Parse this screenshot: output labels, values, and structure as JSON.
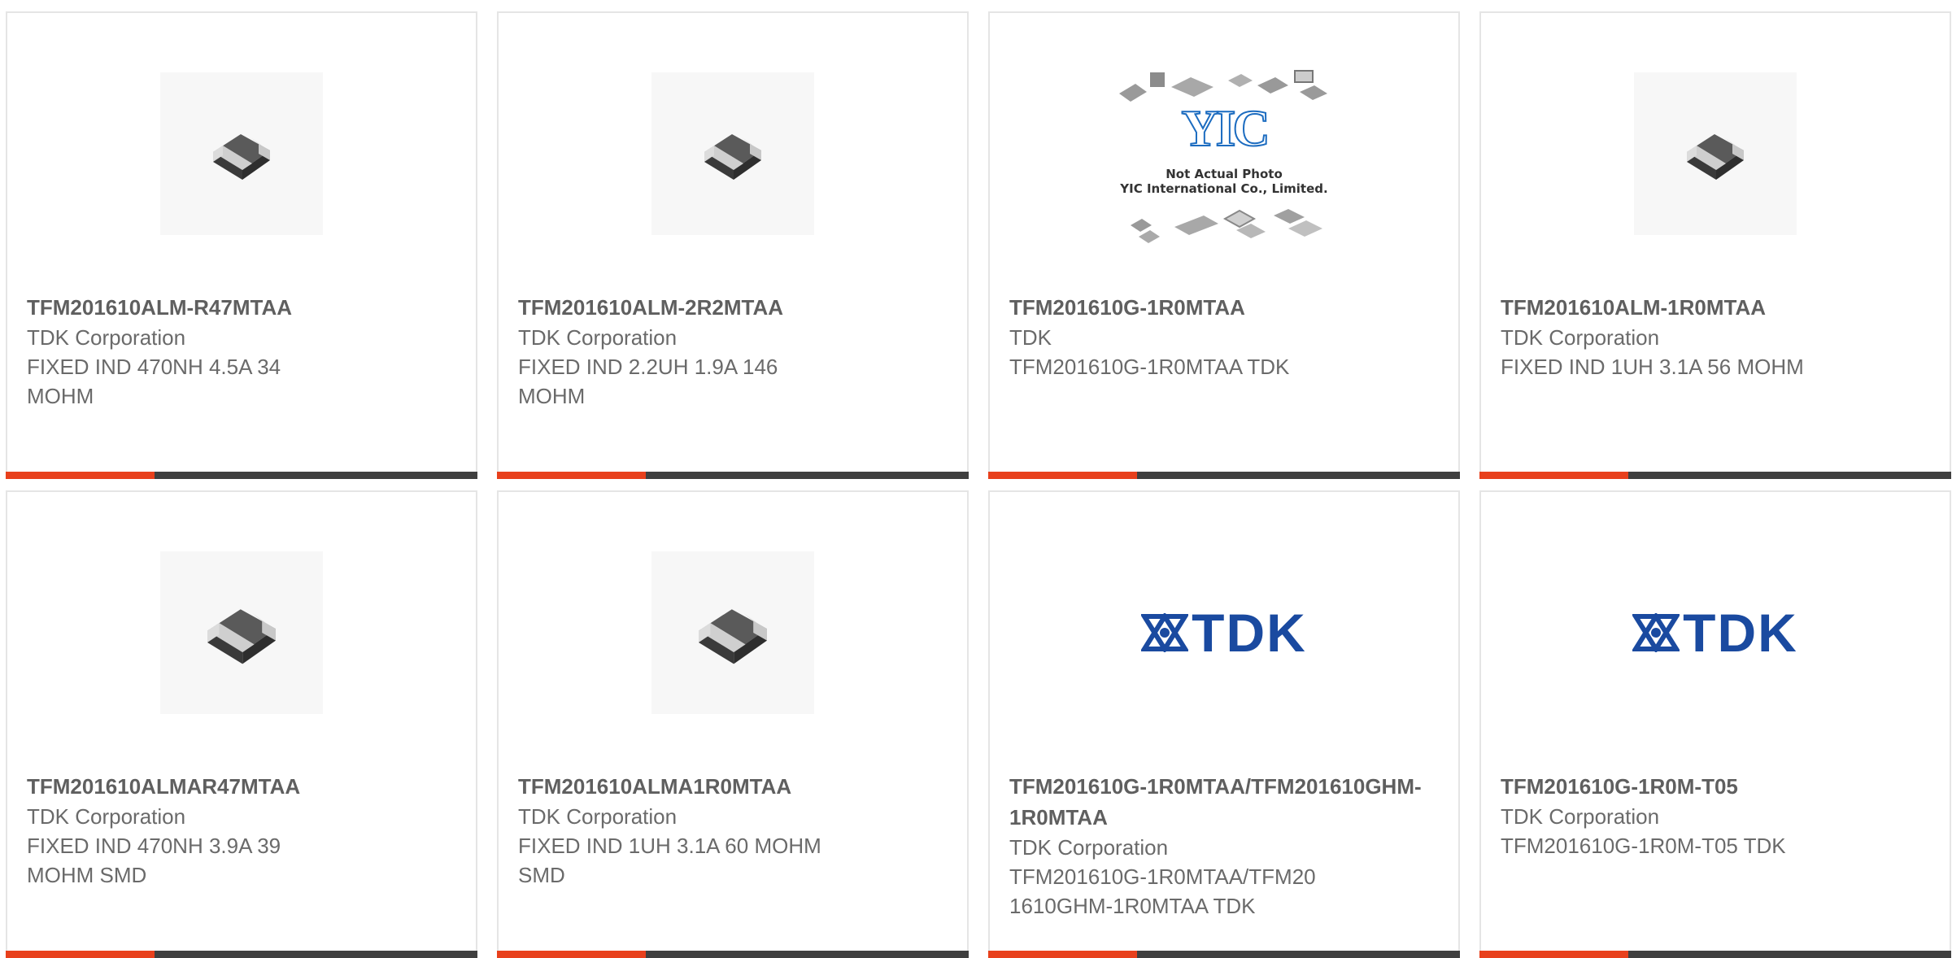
{
  "products": [
    {
      "part_number": "TFM201610ALM-R47MTAA",
      "manufacturer": "TDK Corporation",
      "description": "FIXED IND 470NH 4.5A 34 MOHM",
      "image": "chip-inductor"
    },
    {
      "part_number": "TFM201610ALM-2R2MTAA",
      "manufacturer": "TDK Corporation",
      "description": "FIXED IND 2.2UH 1.9A 146 MOHM",
      "image": "chip-inductor"
    },
    {
      "part_number": "TFM201610G-1R0MTAA",
      "manufacturer": "TDK",
      "description": "TFM201610G-1R0MTAA TDK",
      "image": "yic-placeholder"
    },
    {
      "part_number": "TFM201610ALM-1R0MTAA",
      "manufacturer": "TDK Corporation",
      "description": "FIXED IND 1UH 3.1A 56 MOHM",
      "image": "chip-inductor"
    },
    {
      "part_number": "TFM201610ALMAR47MTAA",
      "manufacturer": "TDK Corporation",
      "description": "FIXED IND 470NH 3.9A 39 MOHM SMD",
      "image": "chip-inductor"
    },
    {
      "part_number": "TFM201610ALMA1R0MTAA",
      "manufacturer": "TDK Corporation",
      "description": "FIXED IND 1UH 3.1A 60 MOHM SMD",
      "image": "chip-inductor"
    },
    {
      "part_number": "TFM201610G-1R0MTAA/TFM201610GHM-1R0MTAA",
      "manufacturer": "TDK Corporation",
      "description": "TFM201610G-1R0MTAA/TFM201610GHM-1R0MTAA TDK",
      "image": "tdk-logo"
    },
    {
      "part_number": "TFM201610G-1R0M-T05",
      "manufacturer": "TDK Corporation",
      "description": "TFM201610G-1R0M-T05 TDK",
      "image": "tdk-logo"
    }
  ],
  "placeholder_image": {
    "logo_text": "YIC",
    "caption_line1": "Not Actual Photo",
    "caption_line2": "YIC International Co., Limited."
  },
  "tdk_logo": {
    "text": "TDK"
  },
  "colors": {
    "accent": "#e8401c",
    "bar": "#3f3f3f",
    "tdk_blue": "#1a4aa0"
  }
}
